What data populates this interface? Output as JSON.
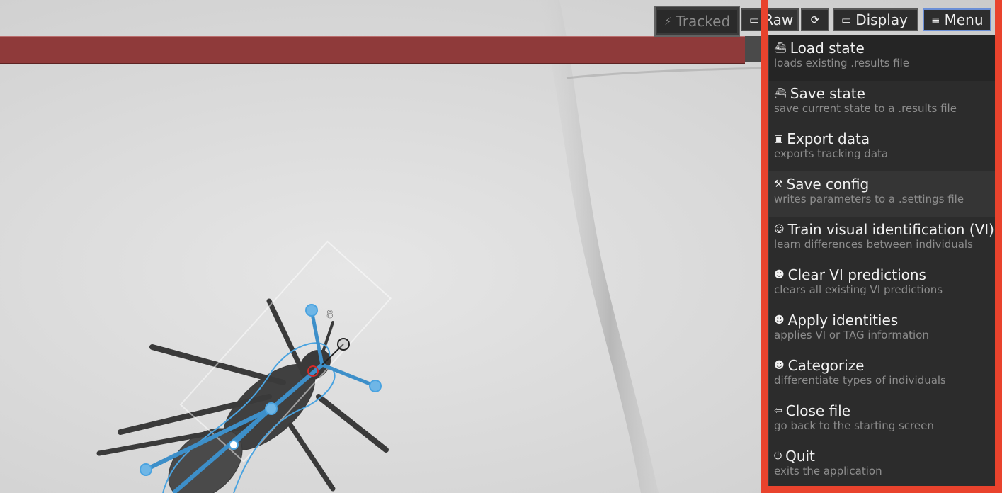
{
  "toolbar": {
    "tracked": {
      "label": "Tracked",
      "icon": "lightning-icon"
    },
    "raw": {
      "label": "Raw",
      "icon": "film-icon"
    },
    "refresh": {
      "icon": "refresh-icon"
    },
    "display": {
      "label": "Display",
      "icon": "monitor-icon"
    },
    "menu": {
      "label": "Menu",
      "icon": "hamburger-icon"
    }
  },
  "overlay": {
    "individual_id": "8"
  },
  "menu": {
    "items": [
      {
        "title": "Load state",
        "description": "loads existing .results file",
        "icon": "load-icon"
      },
      {
        "title": "Save state",
        "description": "save current state to a .results file",
        "icon": "save-state-icon"
      },
      {
        "title": "Export data",
        "description": "exports tracking data",
        "icon": "floppy-icon"
      },
      {
        "title": "Save config",
        "description": "writes parameters to a .settings file",
        "icon": "tools-icon"
      },
      {
        "title": "Train visual identification (VI)",
        "description": "learn differences between individuals",
        "icon": "masks-icon"
      },
      {
        "title": "Clear VI predictions",
        "description": "clears all existing VI predictions",
        "icon": "skull-icon"
      },
      {
        "title": "Apply identities",
        "description": "applies VI or TAG information",
        "icon": "skull-icon"
      },
      {
        "title": "Categorize",
        "description": "differentiate types of individuals",
        "icon": "skull-icon"
      },
      {
        "title": "Close file",
        "description": "go back to the starting screen",
        "icon": "back-arrow-icon"
      },
      {
        "title": "Quit",
        "description": "exits the application",
        "icon": "power-icon"
      }
    ]
  },
  "colors": {
    "accent": "#e9432d",
    "tracking_blue": "#4aa3e0",
    "timeline_red": "#8f3a3a"
  }
}
